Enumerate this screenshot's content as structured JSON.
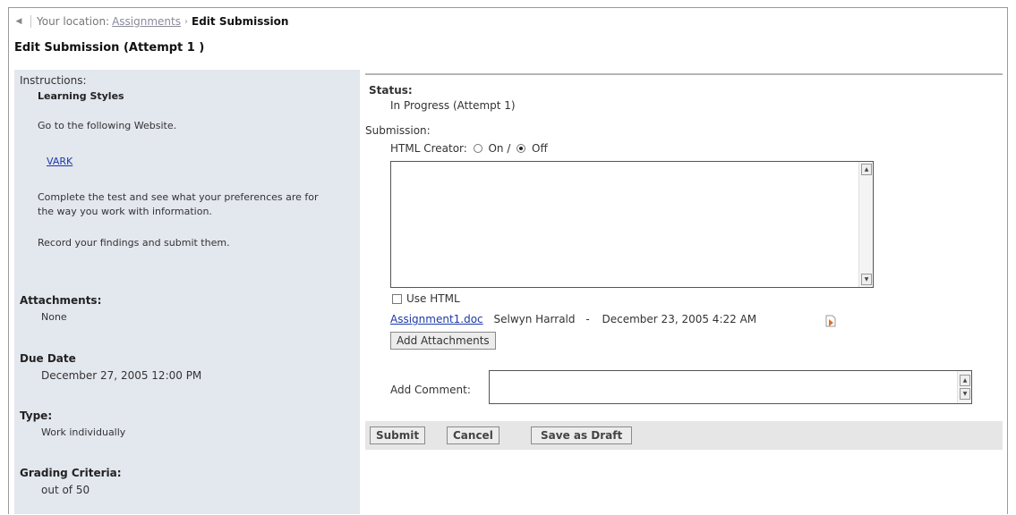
{
  "breadcrumb": {
    "prefix": "Your location:",
    "link": "Assignments",
    "separator": "›",
    "current": "Edit Submission"
  },
  "page_title": "Edit Submission (Attempt 1 )",
  "left": {
    "instructions_label": "Instructions:",
    "instructions_title": "Learning Styles",
    "instructions_line1": "Go to the following Website.",
    "instructions_link": "VARK",
    "instructions_line2a": "Complete the test and see what your preferences are for",
    "instructions_line2b": "the way you work with information.",
    "instructions_line3": "Record your findings and submit them.",
    "attachments_label": "Attachments:",
    "attachments_value": "None",
    "due_label": "Due Date",
    "due_value": "December 27, 2005 12:00 PM",
    "type_label": "Type:",
    "type_value": "Work individually",
    "grading_label": "Grading Criteria:",
    "grading_value": "out of 50"
  },
  "right": {
    "status_label": "Status:",
    "status_value": "In Progress (Attempt 1)",
    "submission_label": "Submission:",
    "html_creator_label": "HTML Creator:",
    "html_on_label": "On /",
    "html_off_label": "Off",
    "html_creator_selected": "Off",
    "use_html_label": "Use HTML",
    "attachment_file": "Assignment1.doc",
    "attachment_author": "Selwyn Harrald",
    "attachment_dash": "-",
    "attachment_date": "December 23, 2005 4:22 AM",
    "add_attachments_label": "Add Attachments",
    "add_comment_label": "Add Comment:",
    "submit_label": "Submit",
    "cancel_label": "Cancel",
    "save_draft_label": "Save as Draft"
  }
}
